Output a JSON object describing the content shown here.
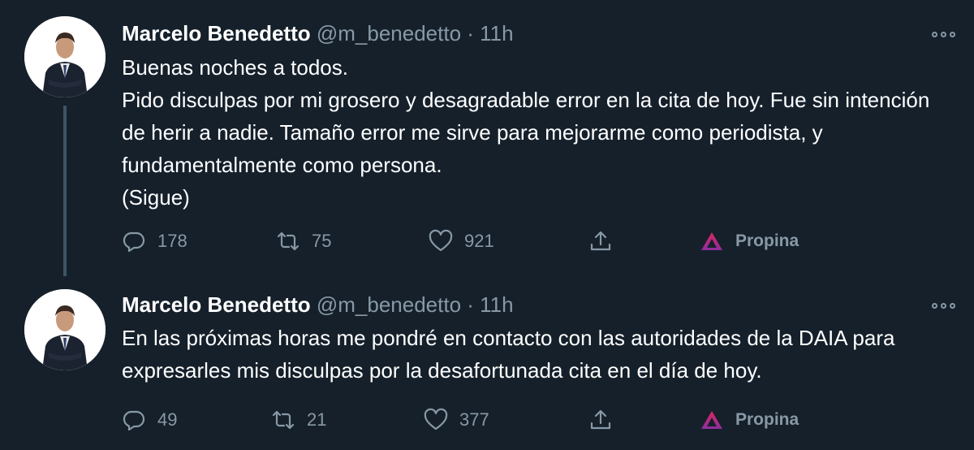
{
  "tweets": [
    {
      "author_name": "Marcelo Benedetto",
      "handle": "@m_benedetto",
      "time": "· 11h",
      "text": "Buenas noches a todos.\nPido disculpas por mi grosero y desagradable error en la cita de hoy. Fue sin intención de herir a nadie. Tamaño error me sirve para mejorarme como periodista, y fundamentalmente como persona.\n(Sigue)",
      "replies": "178",
      "retweets": "75",
      "likes": "921",
      "tip_label": "Propina"
    },
    {
      "author_name": "Marcelo Benedetto",
      "handle": "@m_benedetto",
      "time": "· 11h",
      "text": "En las próximas horas me pondré en contacto con las autoridades de la DAIA para expresarles mis disculpas por la desafortunada cita en el día de hoy.",
      "replies": "49",
      "retweets": "21",
      "likes": "377",
      "tip_label": "Propina"
    }
  ],
  "icons": {
    "reply": "reply-icon",
    "retweet": "retweet-icon",
    "like": "heart-icon",
    "share": "share-icon",
    "tip": "tip-icon",
    "more": "more-icon"
  },
  "colors": {
    "background": "#15202b",
    "secondary_text": "#8899a6",
    "tip_gradient_top": "#e0245e",
    "tip_gradient_bottom": "#8b2ea0"
  }
}
